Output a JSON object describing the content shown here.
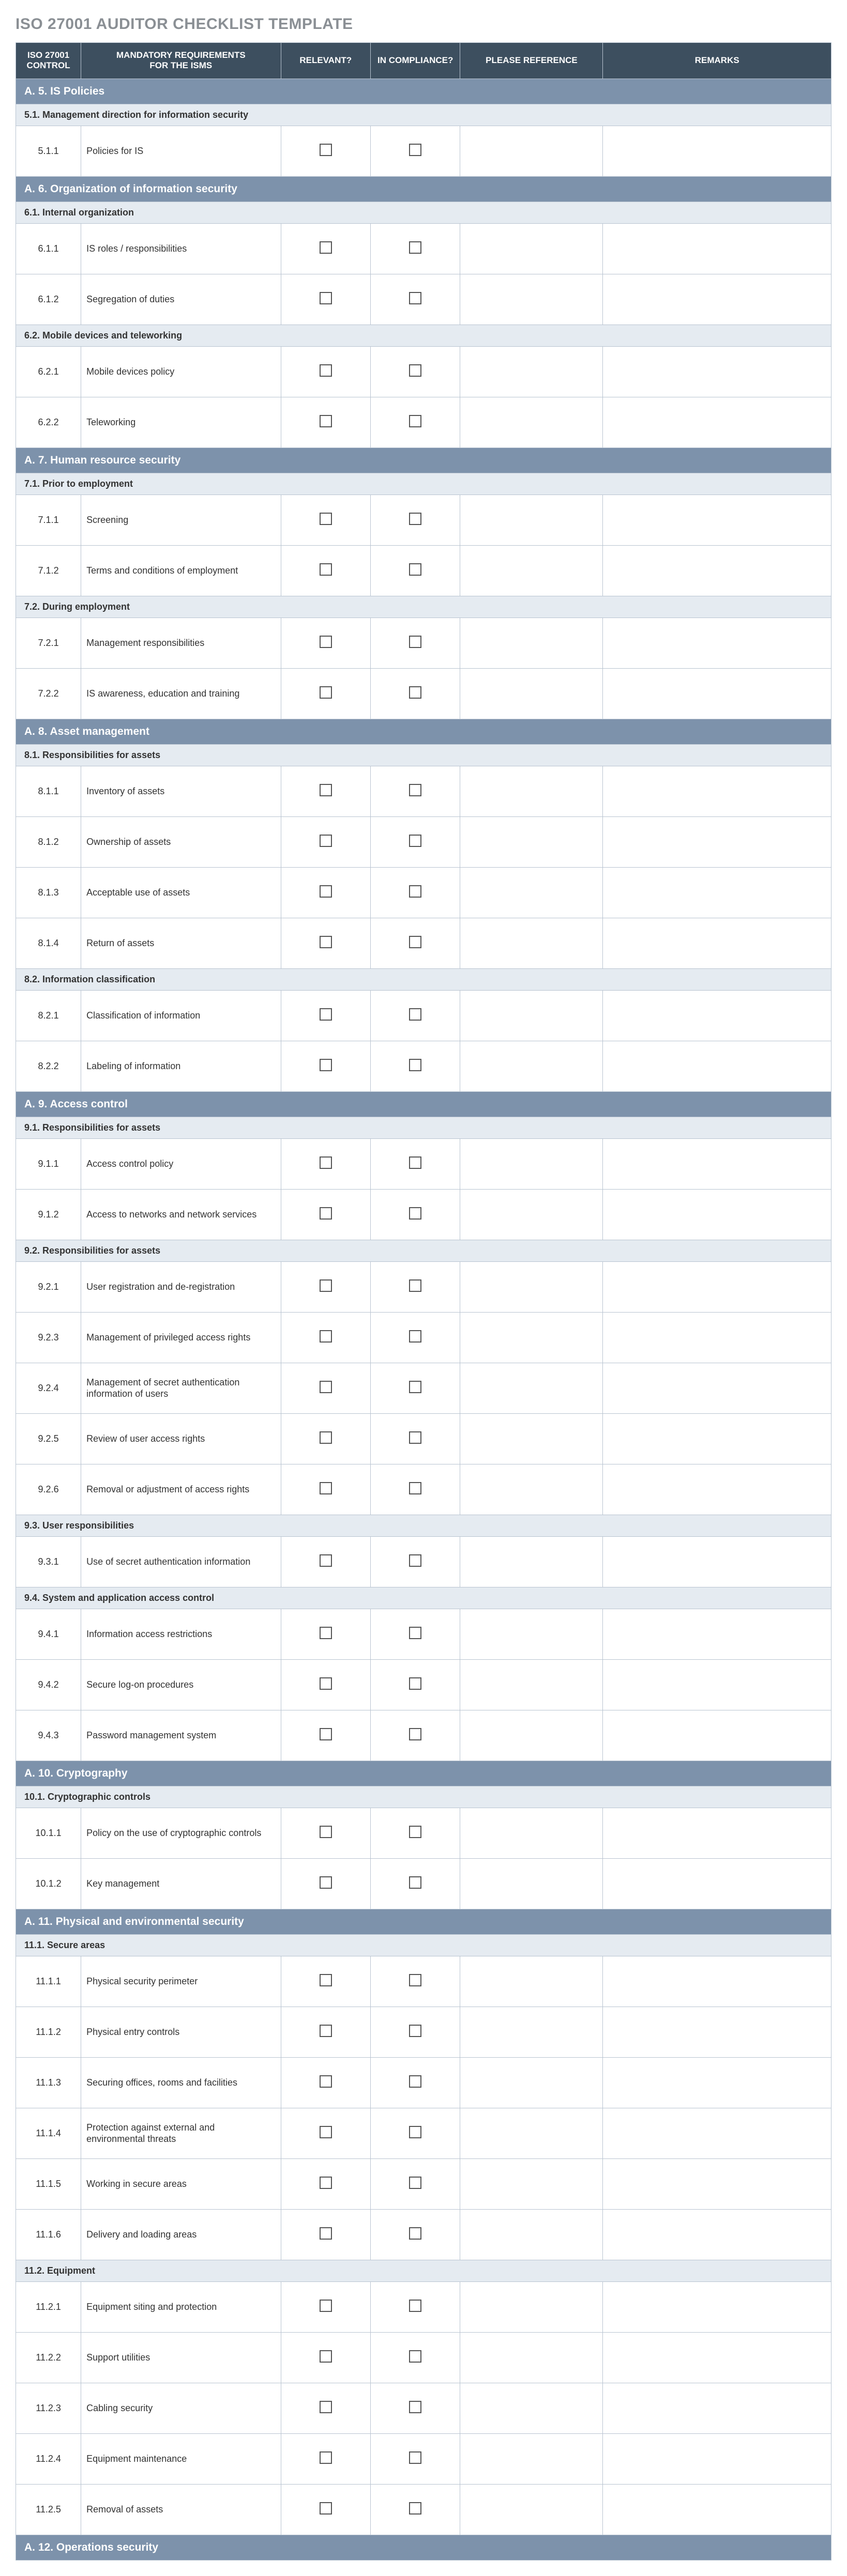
{
  "title": "ISO 27001 AUDITOR CHECKLIST TEMPLATE",
  "headers": {
    "control": "ISO 27001\nCONTROL",
    "requirements": "MANDATORY REQUIREMENTS\nFOR THE ISMS",
    "relevant": "RELEVANT?",
    "compliance": "IN COMPLIANCE?",
    "reference": "PLEASE REFERENCE",
    "remarks": "REMARKS"
  },
  "sections": [
    {
      "title": "A. 5. IS Policies",
      "subsections": [
        {
          "title": "5.1. Management direction for information security",
          "rows": [
            {
              "id": "5.1.1",
              "req": "Policies for IS"
            }
          ]
        }
      ]
    },
    {
      "title": "A. 6. Organization of information security",
      "subsections": [
        {
          "title": "6.1. Internal organization",
          "rows": [
            {
              "id": "6.1.1",
              "req": "IS roles / responsibilities"
            },
            {
              "id": "6.1.2",
              "req": "Segregation of duties"
            }
          ]
        },
        {
          "title": "6.2. Mobile devices and teleworking",
          "rows": [
            {
              "id": "6.2.1",
              "req": "Mobile devices policy"
            },
            {
              "id": "6.2.2",
              "req": "Teleworking"
            }
          ]
        }
      ]
    },
    {
      "title": "A. 7. Human resource security",
      "subsections": [
        {
          "title": "7.1. Prior to employment",
          "rows": [
            {
              "id": "7.1.1",
              "req": "Screening"
            },
            {
              "id": "7.1.2",
              "req": "Terms and conditions of employment"
            }
          ]
        },
        {
          "title": "7.2. During employment",
          "rows": [
            {
              "id": "7.2.1",
              "req": "Management responsibilities"
            },
            {
              "id": "7.2.2",
              "req": "IS awareness, education and training"
            }
          ]
        }
      ]
    },
    {
      "title": "A. 8. Asset management",
      "subsections": [
        {
          "title": "8.1. Responsibilities for assets",
          "rows": [
            {
              "id": "8.1.1",
              "req": "Inventory of assets"
            },
            {
              "id": "8.1.2",
              "req": "Ownership of assets"
            },
            {
              "id": "8.1.3",
              "req": "Acceptable use of assets"
            },
            {
              "id": "8.1.4",
              "req": "Return of assets"
            }
          ]
        },
        {
          "title": "8.2. Information classification",
          "rows": [
            {
              "id": "8.2.1",
              "req": "Classification of information"
            },
            {
              "id": "8.2.2",
              "req": "Labeling of information"
            }
          ]
        }
      ]
    },
    {
      "title": "A. 9. Access control",
      "subsections": [
        {
          "title": "9.1. Responsibilities for assets",
          "rows": [
            {
              "id": "9.1.1",
              "req": "Access control policy"
            },
            {
              "id": "9.1.2",
              "req": "Access to networks and network services"
            }
          ]
        },
        {
          "title": "9.2. Responsibilities for assets",
          "rows": [
            {
              "id": "9.2.1",
              "req": "User registration and de-registration"
            },
            {
              "id": "9.2.3",
              "req": "Management of privileged access rights"
            },
            {
              "id": "9.2.4",
              "req": "Management of secret authentication information of users"
            },
            {
              "id": "9.2.5",
              "req": "Review of user access rights"
            },
            {
              "id": "9.2.6",
              "req": "Removal or adjustment of access rights"
            }
          ]
        },
        {
          "title": "9.3. User responsibilities",
          "rows": [
            {
              "id": "9.3.1",
              "req": "Use of secret authentication information"
            }
          ]
        },
        {
          "title": "9.4. System and application access control",
          "rows": [
            {
              "id": "9.4.1",
              "req": "Information access restrictions"
            },
            {
              "id": "9.4.2",
              "req": "Secure log-on procedures"
            },
            {
              "id": "9.4.3",
              "req": "Password management system"
            }
          ]
        }
      ]
    },
    {
      "title": "A. 10. Cryptography",
      "subsections": [
        {
          "title": "10.1. Cryptographic controls",
          "rows": [
            {
              "id": "10.1.1",
              "req": "Policy on the use of cryptographic controls"
            },
            {
              "id": "10.1.2",
              "req": "Key management"
            }
          ]
        }
      ]
    },
    {
      "title": "A. 11. Physical and environmental security",
      "subsections": [
        {
          "title": "11.1. Secure areas",
          "rows": [
            {
              "id": "11.1.1",
              "req": "Physical security perimeter"
            },
            {
              "id": "11.1.2",
              "req": "Physical entry controls"
            },
            {
              "id": "11.1.3",
              "req": "Securing offices, rooms and facilities"
            },
            {
              "id": "11.1.4",
              "req": "Protection against external and environmental threats"
            },
            {
              "id": "11.1.5",
              "req": "Working in secure areas"
            },
            {
              "id": "11.1.6",
              "req": "Delivery and loading areas"
            }
          ]
        },
        {
          "title": "11.2. Equipment",
          "rows": [
            {
              "id": "11.2.1",
              "req": "Equipment siting and protection"
            },
            {
              "id": "11.2.2",
              "req": "Support utilities"
            },
            {
              "id": "11.2.3",
              "req": "Cabling security"
            },
            {
              "id": "11.2.4",
              "req": "Equipment maintenance"
            },
            {
              "id": "11.2.5",
              "req": "Removal of assets"
            }
          ]
        }
      ]
    },
    {
      "title": "A. 12. Operations security",
      "subsections": []
    }
  ]
}
